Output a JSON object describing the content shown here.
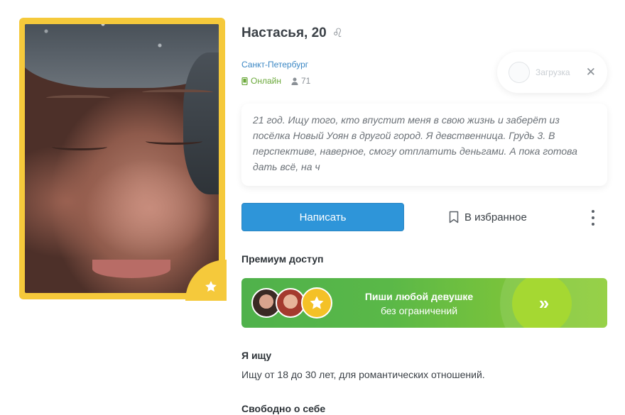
{
  "profile": {
    "name_age": "Настасья, 20",
    "zodiac_symbol": "♌",
    "city": "Санкт-Петербург",
    "online_label": "Онлайн",
    "views_count": "71",
    "about": "21 год. Ищу того, кто впустит меня в свою жизнь и заберёт из посёлка Новый Уоян в другой город. Я девственница. Грудь 3. В перспективе, наверное, смогу отплатить деньгами. А пока готова дать всё, на ч"
  },
  "tooltip": {
    "text": "Загрузка",
    "close_symbol": "✕"
  },
  "actions": {
    "write_label": "Написать",
    "favorite_label": "В избранное"
  },
  "premium": {
    "section_title": "Премиум доступ",
    "banner_title": "Пиши любой девушке",
    "banner_subtitle": "без ограничений",
    "arrow_symbol": "»"
  },
  "seeking": {
    "section_title": "Я ищу",
    "text": "Ищу от 18 до 30 лет, для романтических отношений."
  },
  "free_about": {
    "section_title": "Свободно о себе"
  },
  "colors": {
    "accent_blue": "#2e95d9",
    "gold": "#f5c93b",
    "online_green": "#6aa83a",
    "banner_green": "#5ab848"
  }
}
